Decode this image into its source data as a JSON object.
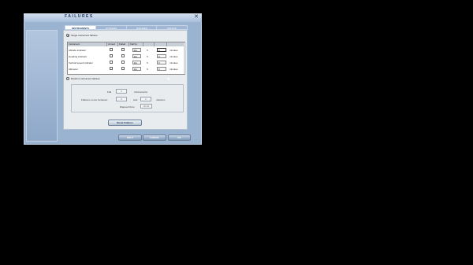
{
  "window": {
    "title": "FAILURES",
    "close_glyph": "✕"
  },
  "tabs": [
    {
      "label": "INSTRUMENTS",
      "active": true
    },
    {
      "label": "SYSTEMS",
      "active": false
    },
    {
      "label": "ENGINES",
      "active": false
    },
    {
      "label": "RADIOS",
      "active": false
    }
  ],
  "single": {
    "label": "Single instrument failures",
    "selected": true,
    "columns": [
      "Instrument",
      "Armed",
      "Failed",
      "Fail by",
      "",
      "",
      ""
    ],
    "rows": [
      {
        "name": "Altitude indicator",
        "failby": "kts",
        "unit_a": "ft",
        "value": "0",
        "unit_b": "minutes"
      },
      {
        "name": "Heading indicator",
        "failby": "kts",
        "unit_a": "ft",
        "value": "0",
        "unit_b": "minutes"
      },
      {
        "name": "Vertical speed indicator",
        "failby": "kts",
        "unit_a": "ft",
        "value": "0",
        "unit_b": "minutes"
      },
      {
        "name": "Altimeter",
        "failby": "kts",
        "unit_a": "ft",
        "value": "0",
        "unit_b": "minutes"
      }
    ]
  },
  "random": {
    "label": "Random instrument failures",
    "fail_label": "Fail",
    "fail_value": "0",
    "instruments_label": "instruments",
    "between_label": "Failures occur between",
    "between_from": "0",
    "and_label": "and",
    "between_to": "0",
    "minutes_label": "minutes",
    "elapsed_label": "Elapsed time",
    "elapsed_value": "00:00"
  },
  "buttons": {
    "reset": "Reset Failures",
    "help": "HELP",
    "cancel": "CANCEL",
    "ok": "OK"
  }
}
